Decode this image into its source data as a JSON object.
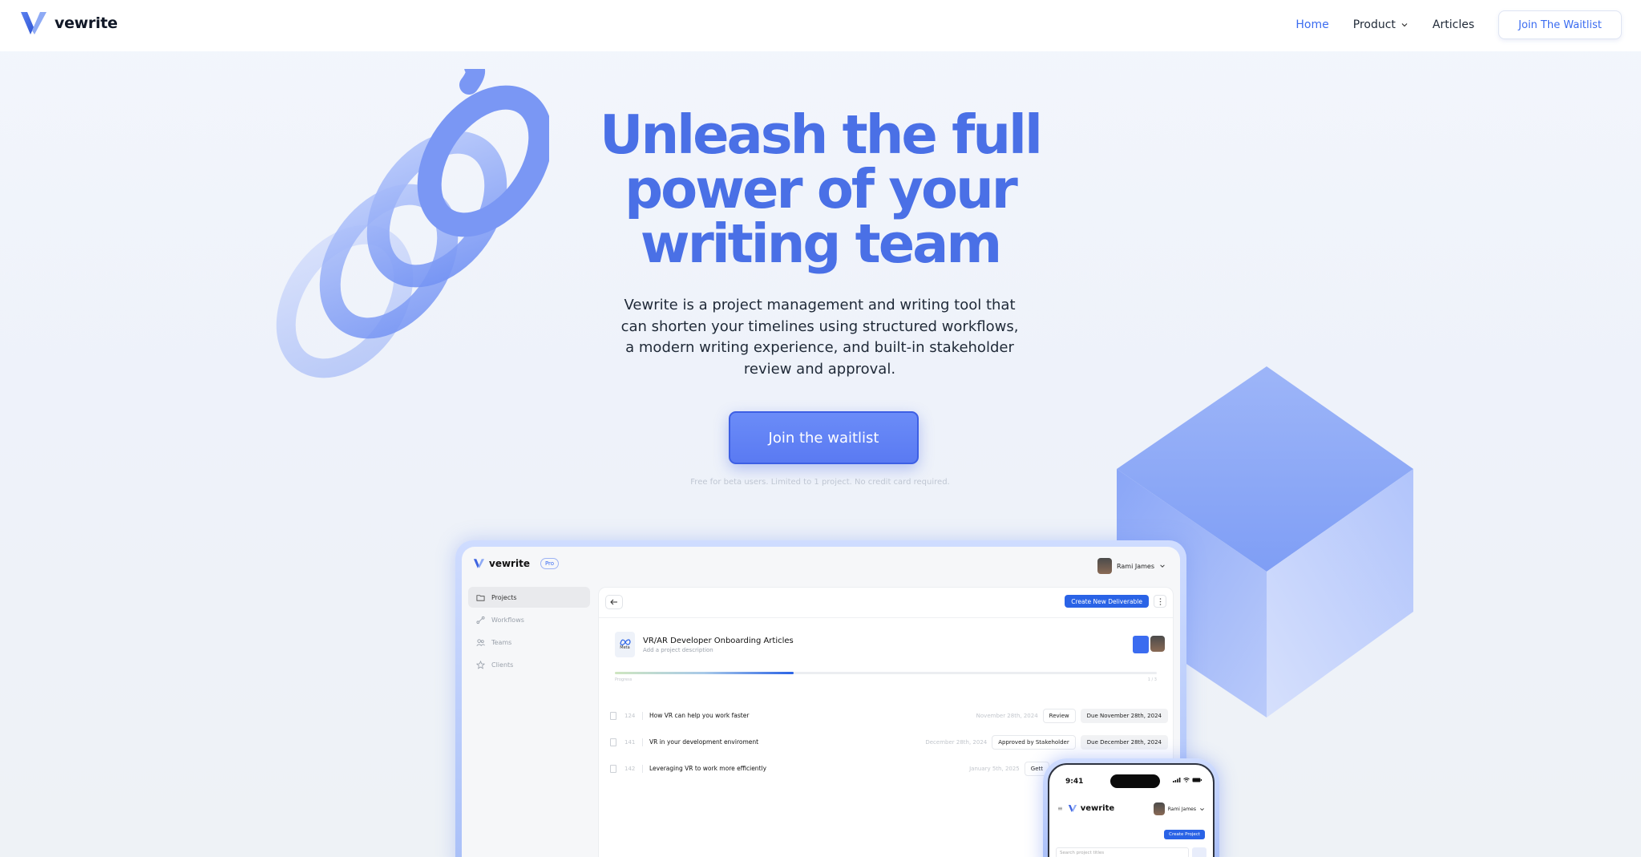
{
  "nav": {
    "brand": "vewrite",
    "links": [
      {
        "label": "Home",
        "active": true
      },
      {
        "label": "Product",
        "dropdown": true
      },
      {
        "label": "Articles"
      }
    ],
    "cta": "Join The Waitlist"
  },
  "hero": {
    "title_lines": [
      "Unleash the full",
      "power of your",
      "writing team"
    ],
    "subtitle": "Vewrite is a project management and writing tool that can shorten your timelines using structured workflows, a modern writing experience, and built-in stakeholder review and approval.",
    "cta": "Join the waitlist",
    "note": "Free for beta users. Limited to 1 project. No credit card required."
  },
  "desktop": {
    "brand": "vewrite",
    "badge": "Pro",
    "user": "Rami James",
    "sidebar": [
      {
        "label": "Projects",
        "icon": "folder-icon",
        "active": true
      },
      {
        "label": "Workflows",
        "icon": "workflow-icon"
      },
      {
        "label": "Teams",
        "icon": "users-icon"
      },
      {
        "label": "Clients",
        "icon": "star-icon"
      }
    ],
    "create_button": "Create New Deliverable",
    "project": {
      "logo_text": "Meta",
      "title": "VR/AR Developer Onboarding Articles",
      "description": "Add a project description",
      "progress_label": "Progress",
      "progress_count": "1 / 3",
      "progress": 0.33
    },
    "deliverables": [
      {
        "id": "124",
        "title": "How VR can help you work faster",
        "date": "November 28th, 2024",
        "status": "Review",
        "due": "Due November 28th, 2024"
      },
      {
        "id": "141",
        "title": "VR in your development enviroment",
        "date": "December 28th, 2024",
        "status": "Approved by Stakeholder",
        "due": "Due December 28th, 2024"
      },
      {
        "id": "142",
        "title": "Leveraging VR to work more efficiently",
        "date": "January 5th, 2025",
        "status": "Gett",
        "due": ""
      }
    ]
  },
  "phone": {
    "time": "9:41",
    "brand": "vewrite",
    "user": "Rami James",
    "create_button": "Create Project",
    "search_placeholder": "Search project titles"
  },
  "colors": {
    "accent": "#4a70e6",
    "primary_button": "#5a7af2",
    "app_blue": "#2a63e6"
  }
}
